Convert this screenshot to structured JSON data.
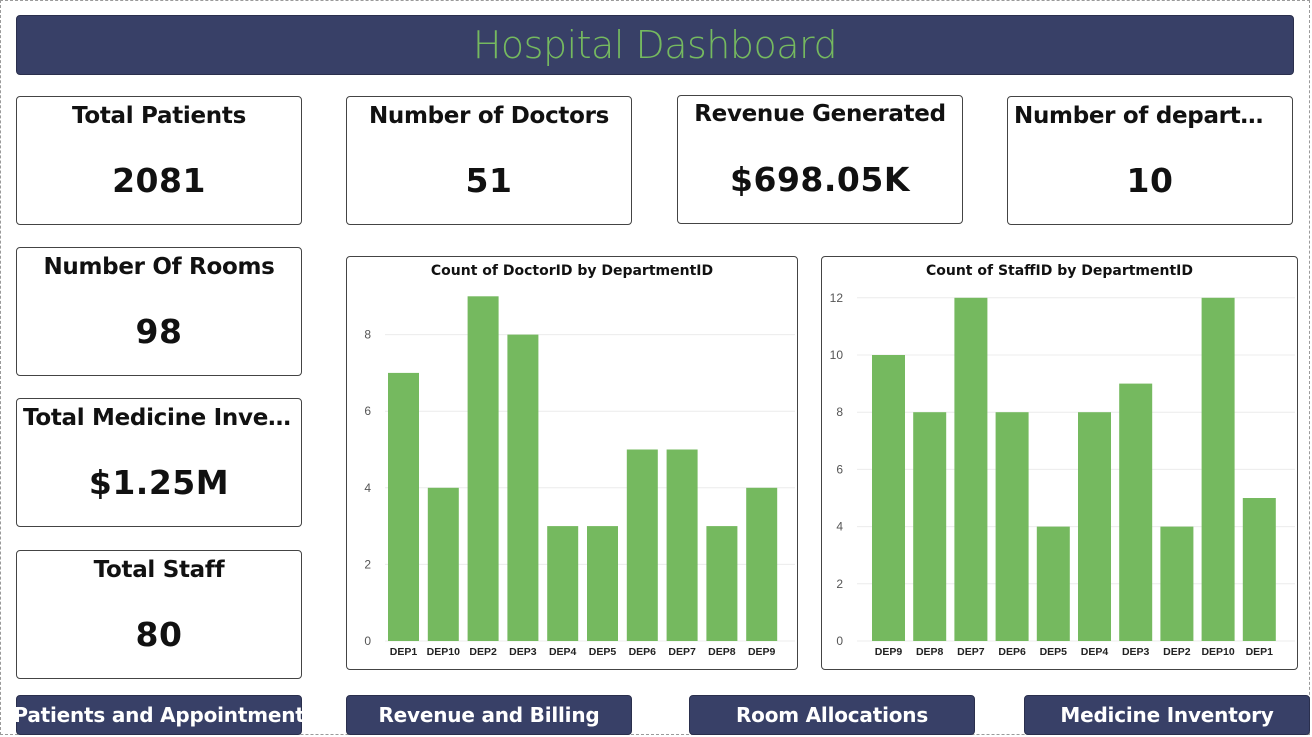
{
  "title": "Hospital Dashboard",
  "kpis": {
    "total_patients": {
      "label": "Total Patients",
      "value": "2081"
    },
    "num_doctors": {
      "label": "Number of Doctors",
      "value": "51"
    },
    "revenue": {
      "label": "Revenue Generated",
      "value": "$698.05K"
    },
    "num_departments": {
      "label": "Number of departme...",
      "value": "10"
    },
    "num_rooms": {
      "label": "Number Of Rooms",
      "value": "98"
    },
    "medicine_inventory": {
      "label": "Total Medicine Invent...",
      "value": "$1.25M"
    },
    "total_staff": {
      "label": "Total Staff",
      "value": "80"
    }
  },
  "nav": {
    "patients": "Patients and Appointment",
    "revenue": "Revenue and Billing",
    "rooms": "Room Allocations",
    "medicine": "Medicine Inventory"
  },
  "colors": {
    "banner": "#384067",
    "accent": "#75b95f",
    "bar": "#75b95f"
  },
  "chart_data": [
    {
      "type": "bar",
      "title": "Count of DoctorID by DepartmentID",
      "categories": [
        "DEP1",
        "DEP10",
        "DEP2",
        "DEP3",
        "DEP4",
        "DEP5",
        "DEP6",
        "DEP7",
        "DEP8",
        "DEP9"
      ],
      "values": [
        7,
        4,
        9,
        8,
        3,
        3,
        5,
        5,
        3,
        4
      ],
      "ylim": [
        0,
        9
      ],
      "yticks": [
        0,
        2,
        4,
        6,
        8
      ],
      "grid": true
    },
    {
      "type": "bar",
      "title": "Count of StaffID by DepartmentID",
      "categories": [
        "DEP9",
        "DEP8",
        "DEP7",
        "DEP6",
        "DEP5",
        "DEP4",
        "DEP3",
        "DEP2",
        "DEP10",
        "DEP1"
      ],
      "values": [
        10,
        8,
        12,
        8,
        4,
        8,
        9,
        4,
        12,
        5
      ],
      "ylim": [
        0,
        12
      ],
      "yticks": [
        0,
        2,
        4,
        6,
        8,
        10,
        12
      ],
      "grid": true
    }
  ]
}
